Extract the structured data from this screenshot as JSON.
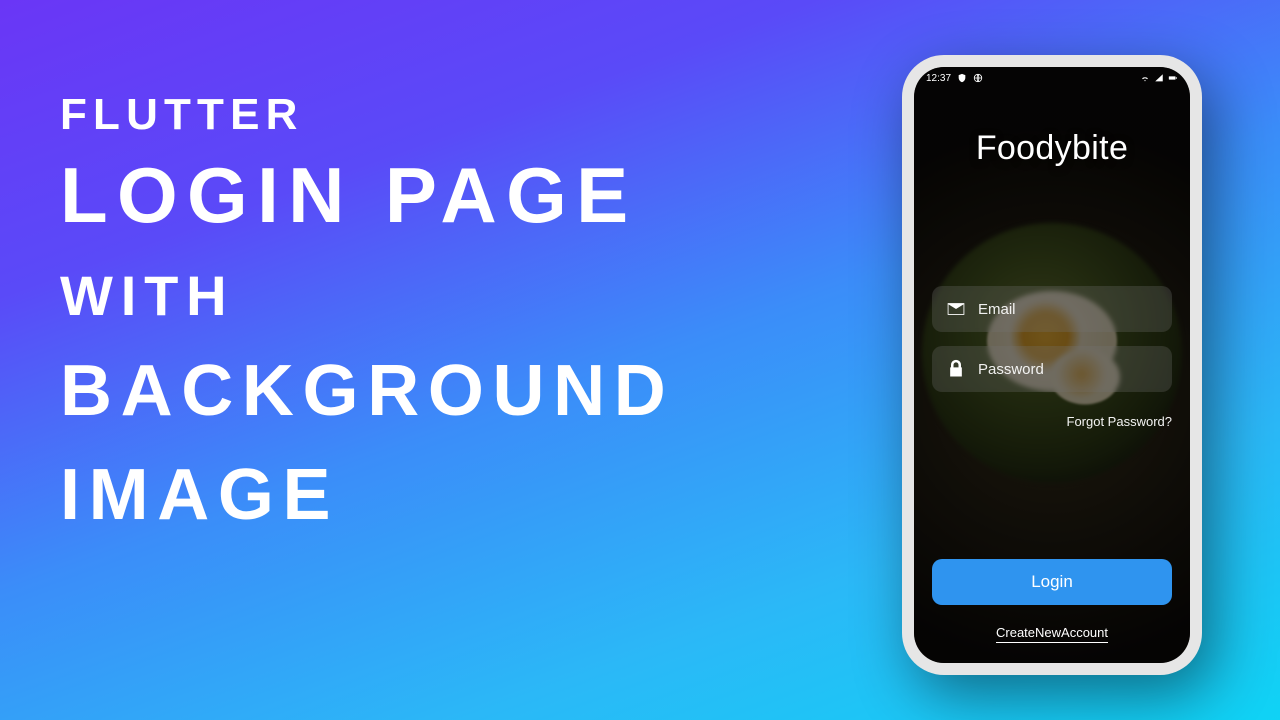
{
  "heading": {
    "line1": "FLUTTER",
    "line2": "LOGIN PAGE",
    "line3": "WITH",
    "line4": "BACKGROUND",
    "line5": "IMAGE"
  },
  "phone": {
    "statusbar": {
      "time": "12:37",
      "icons_left": {
        "shield": "shield-icon",
        "globe": "globe-icon"
      },
      "icons_right": {
        "wifi": "wifi-icon",
        "signal": "signal-icon",
        "battery": "battery-icon"
      }
    },
    "brand": "Foodybite",
    "form": {
      "email": {
        "placeholder": "Email",
        "value": ""
      },
      "password": {
        "placeholder": "Password",
        "value": ""
      },
      "forgot": "Forgot Password?"
    },
    "login_button": "Login",
    "create_account": "CreateNewAccount",
    "colors": {
      "button_bg": "#2f94ef"
    }
  }
}
